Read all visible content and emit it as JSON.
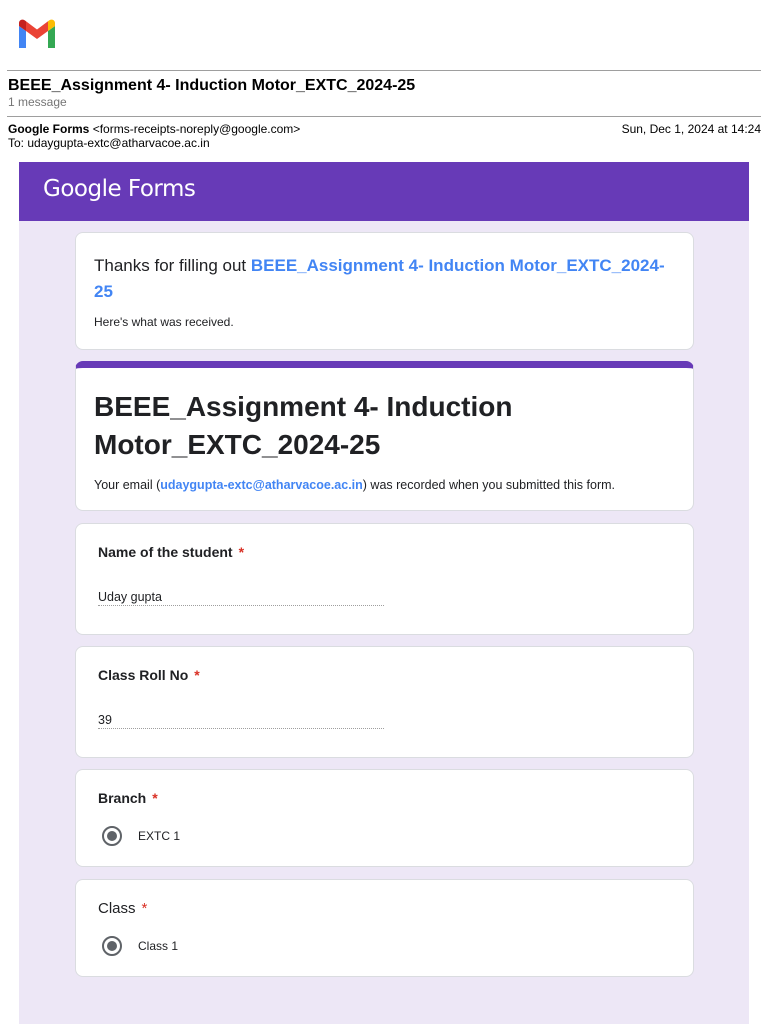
{
  "email": {
    "subject": "BEEE_Assignment 4- Induction Motor_EXTC_2024-25",
    "message_count": "1 message",
    "sender_name": "Google Forms",
    "sender_address": "<forms-receipts-noreply@google.com>",
    "date": "Sun, Dec 1, 2024 at 14:24",
    "to_line": "To: udaygupta-extc@atharvacoe.ac.in"
  },
  "forms": {
    "logo_google": "Google",
    "logo_forms": "Forms",
    "brand_color": "#673ab7",
    "thanks_prefix": "Thanks for filling out ",
    "thanks_form_name": "BEEE_Assignment 4- Induction Motor_EXTC_2024-25",
    "received_note": "Here's what was received.",
    "form_title": "BEEE_Assignment 4- Induction Motor_EXTC_2024-25",
    "email_note_prefix": "Your email (",
    "email_note_address": "udaygupta-extc@atharvacoe.ac.in",
    "email_note_suffix": ") was recorded when you submitted this form."
  },
  "questions": [
    {
      "title": "Name of the student",
      "required_mark": "*",
      "answer": "Uday gupta"
    },
    {
      "title": "Class Roll No",
      "required_mark": "*",
      "answer": "39"
    },
    {
      "title": "Branch",
      "required_mark": "*",
      "selected_option": "EXTC 1"
    },
    {
      "title": "Class",
      "required_mark": "*",
      "selected_option": "Class 1"
    }
  ]
}
